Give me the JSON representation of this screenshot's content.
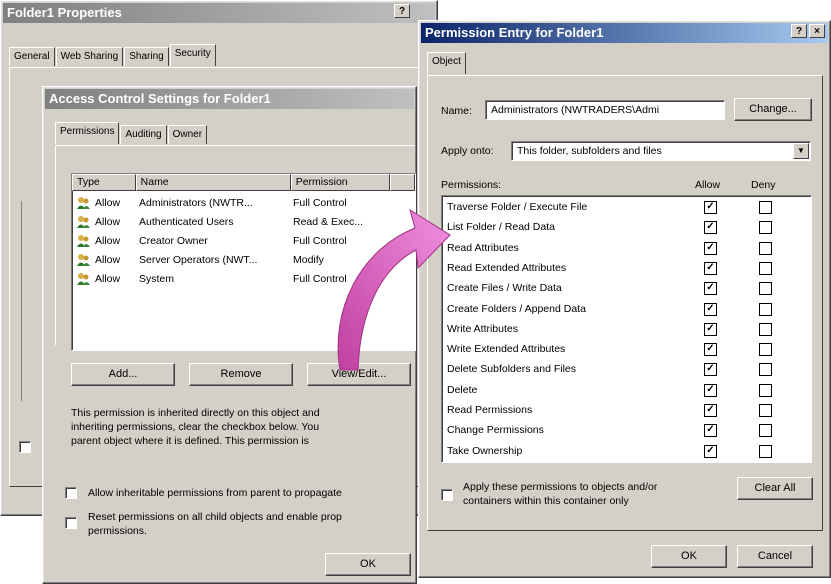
{
  "folder_properties": {
    "title": "Folder1 Properties",
    "help_btn": "?",
    "tabs": [
      "General",
      "Web Sharing",
      "Sharing",
      "Security"
    ],
    "selected_tab": "Security"
  },
  "access_control": {
    "title": "Access Control Settings for Folder1",
    "tabs": [
      "Permissions",
      "Auditing",
      "Owner"
    ],
    "columns": [
      "Type",
      "Name",
      "Permission"
    ],
    "entries": [
      {
        "type": "Allow",
        "name": "Administrators (NWTR...",
        "permission": "Full Control"
      },
      {
        "type": "Allow",
        "name": "Authenticated Users",
        "permission": "Read & Exec..."
      },
      {
        "type": "Allow",
        "name": "Creator Owner",
        "permission": "Full Control"
      },
      {
        "type": "Allow",
        "name": "Server Operators (NWT...",
        "permission": "Modify"
      },
      {
        "type": "Allow",
        "name": "System",
        "permission": "Full Control"
      }
    ],
    "add_btn": "Add...",
    "remove_btn": "Remove",
    "view_edit_btn": "View/Edit...",
    "info_line1": "This permission is inherited directly on this object and",
    "info_line2": "inheriting permissions, clear the checkbox below. You",
    "info_line3": "parent object where it is defined. This  permission is",
    "allow_inheritable": "Allow inheritable permissions from parent to propagate",
    "reset_line1": "Reset permissions on all child objects and enable prop",
    "reset_line2": "permissions.",
    "ok_btn": "OK"
  },
  "permission_entry": {
    "title": "Permission Entry for Folder1",
    "help_btn": "?",
    "close_btn": "×",
    "tab": "Object",
    "name_label": "Name:",
    "name_value": "Administrators (NWTRADERS\\Admi",
    "change_btn": "Change...",
    "apply_onto_label": "Apply onto:",
    "apply_onto_value": "This folder, subfolders and files",
    "permissions_label": "Permissions:",
    "allow_header": "Allow",
    "deny_header": "Deny",
    "permissions": [
      {
        "name": "Traverse Folder / Execute File",
        "allow": true,
        "deny": false
      },
      {
        "name": "List Folder / Read Data",
        "allow": true,
        "deny": false
      },
      {
        "name": "Read Attributes",
        "allow": true,
        "deny": false
      },
      {
        "name": "Read Extended Attributes",
        "allow": true,
        "deny": false
      },
      {
        "name": "Create Files / Write Data",
        "allow": true,
        "deny": false
      },
      {
        "name": "Create Folders / Append Data",
        "allow": true,
        "deny": false
      },
      {
        "name": "Write Attributes",
        "allow": true,
        "deny": false
      },
      {
        "name": "Write Extended Attributes",
        "allow": true,
        "deny": false
      },
      {
        "name": "Delete Subfolders and Files",
        "allow": true,
        "deny": false
      },
      {
        "name": "Delete",
        "allow": true,
        "deny": false
      },
      {
        "name": "Read Permissions",
        "allow": true,
        "deny": false
      },
      {
        "name": "Change Permissions",
        "allow": true,
        "deny": false
      },
      {
        "name": "Take Ownership",
        "allow": true,
        "deny": false
      }
    ],
    "apply_line1": "Apply these permissions to objects and/or",
    "apply_line2": "containers within this container only",
    "clear_all_btn": "Clear All",
    "ok_btn": "OK",
    "cancel_btn": "Cancel"
  },
  "colors": {
    "face": "#d4d0c8",
    "active_title_start": "#0a246a",
    "active_title_end": "#a6caf0",
    "inactive_title_start": "#808080",
    "inactive_title_end": "#c0c0c0",
    "arrow": "#e060c0"
  }
}
